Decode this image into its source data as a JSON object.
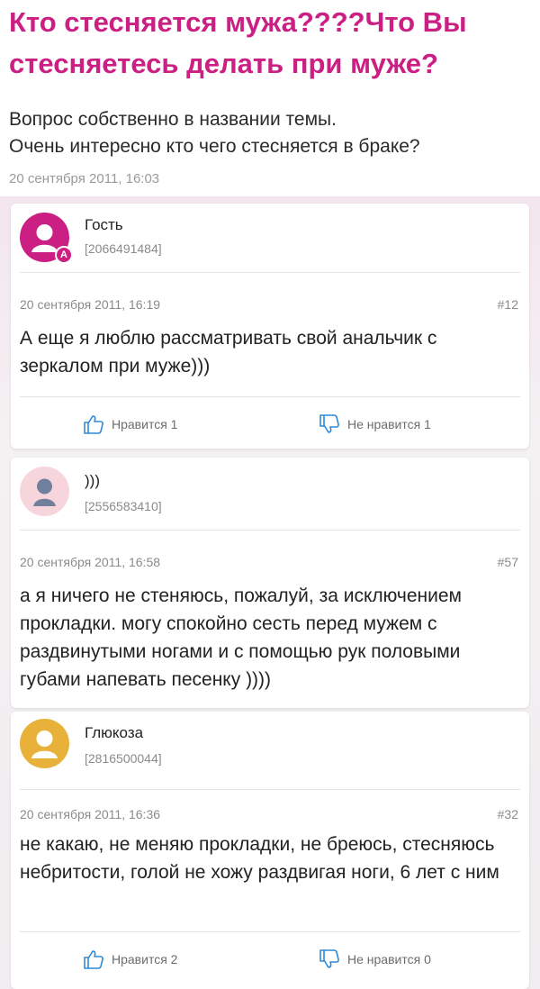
{
  "topic": {
    "title": "Кто стесняется мужа????Что Вы стесняетесь делать при муже?",
    "body_line1": "Вопрос собственно в названии темы.",
    "body_line2": "Очень интересно кто чего стесняется в браке?",
    "date": "20 сентября 2011, 16:03"
  },
  "colors": {
    "accent": "#cb1f84",
    "avatar_guest": "#cb1f84",
    "avatar_pink": "#f6d6dc",
    "avatar_yellow": "#e8b23a"
  },
  "posts": [
    {
      "author": "Гость",
      "id": "[2066491484]",
      "badge": "A",
      "avatar_icon": "user-silhouette-icon",
      "date": "20 сентября 2011, 16:19",
      "number": "#12",
      "text": "А еще я люблю рассматривать свой анальчик с зеркалом при муже)))",
      "like_label": "Нравится 1",
      "dislike_label": "Не нравится 1"
    },
    {
      "author": ")))",
      "id": "[2556583410]",
      "avatar_icon": "user-silhouette-icon",
      "date": "20 сентября 2011, 16:58",
      "number": "#57",
      "text": "а я ничего не стеняюсь, пожалуй, за исключением прокладки. могу спокойно сесть перед мужем с раздвинутыми ногами и с помощью рук половыми губами напевать песенку ))))"
    },
    {
      "author": "Глюкоза",
      "id": "[2816500044]",
      "avatar_icon": "user-silhouette-icon",
      "date": "20 сентября 2011, 16:36",
      "number": "#32",
      "text": "не какаю, не меняю прокладки, не бреюсь, стесняюсь небритости, голой не хожу раздвигая ноги, 6 лет с ним",
      "like_label": "Нравится 2",
      "dislike_label": "Не нравится 0"
    }
  ]
}
